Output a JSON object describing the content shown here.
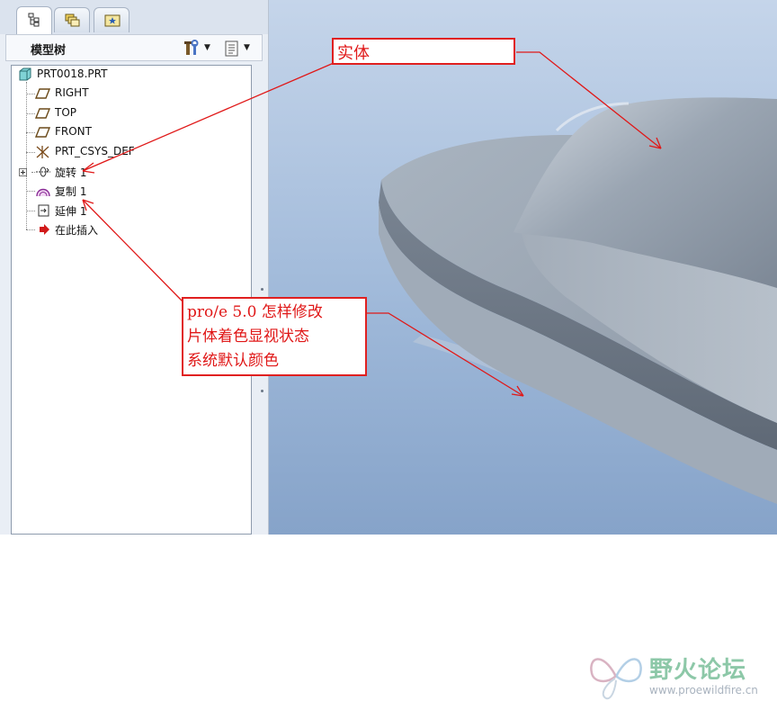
{
  "panel": {
    "tabs": [
      {
        "icon": "model-tree-icon"
      },
      {
        "icon": "layers-icon"
      },
      {
        "icon": "favorites-icon"
      }
    ],
    "title": "模型树",
    "settings_icon": "tree-settings-icon",
    "show_icon": "tree-show-icon"
  },
  "tree": {
    "root": "PRT0018.PRT",
    "items": [
      {
        "label": "RIGHT",
        "icon": "datum-plane-icon"
      },
      {
        "label": "TOP",
        "icon": "datum-plane-icon"
      },
      {
        "label": "FRONT",
        "icon": "datum-plane-icon"
      },
      {
        "label": "PRT_CSYS_DEF",
        "icon": "csys-icon"
      },
      {
        "label": "旋转 1",
        "icon": "revolve-icon"
      },
      {
        "label": "复制 1",
        "icon": "copy-surface-icon"
      },
      {
        "label": "延伸 1",
        "icon": "extend-icon"
      },
      {
        "label": "在此插入",
        "icon": "insert-here-icon"
      }
    ]
  },
  "annotations": {
    "solid_label": "实体",
    "question_lines": [
      "pro/e 5.0 怎样修改",
      "片体着色显视状态",
      "系统默认颜色"
    ],
    "color": "#e01818"
  },
  "watermark": {
    "title": "野火论坛",
    "url": "www.proewildfire.cn"
  }
}
